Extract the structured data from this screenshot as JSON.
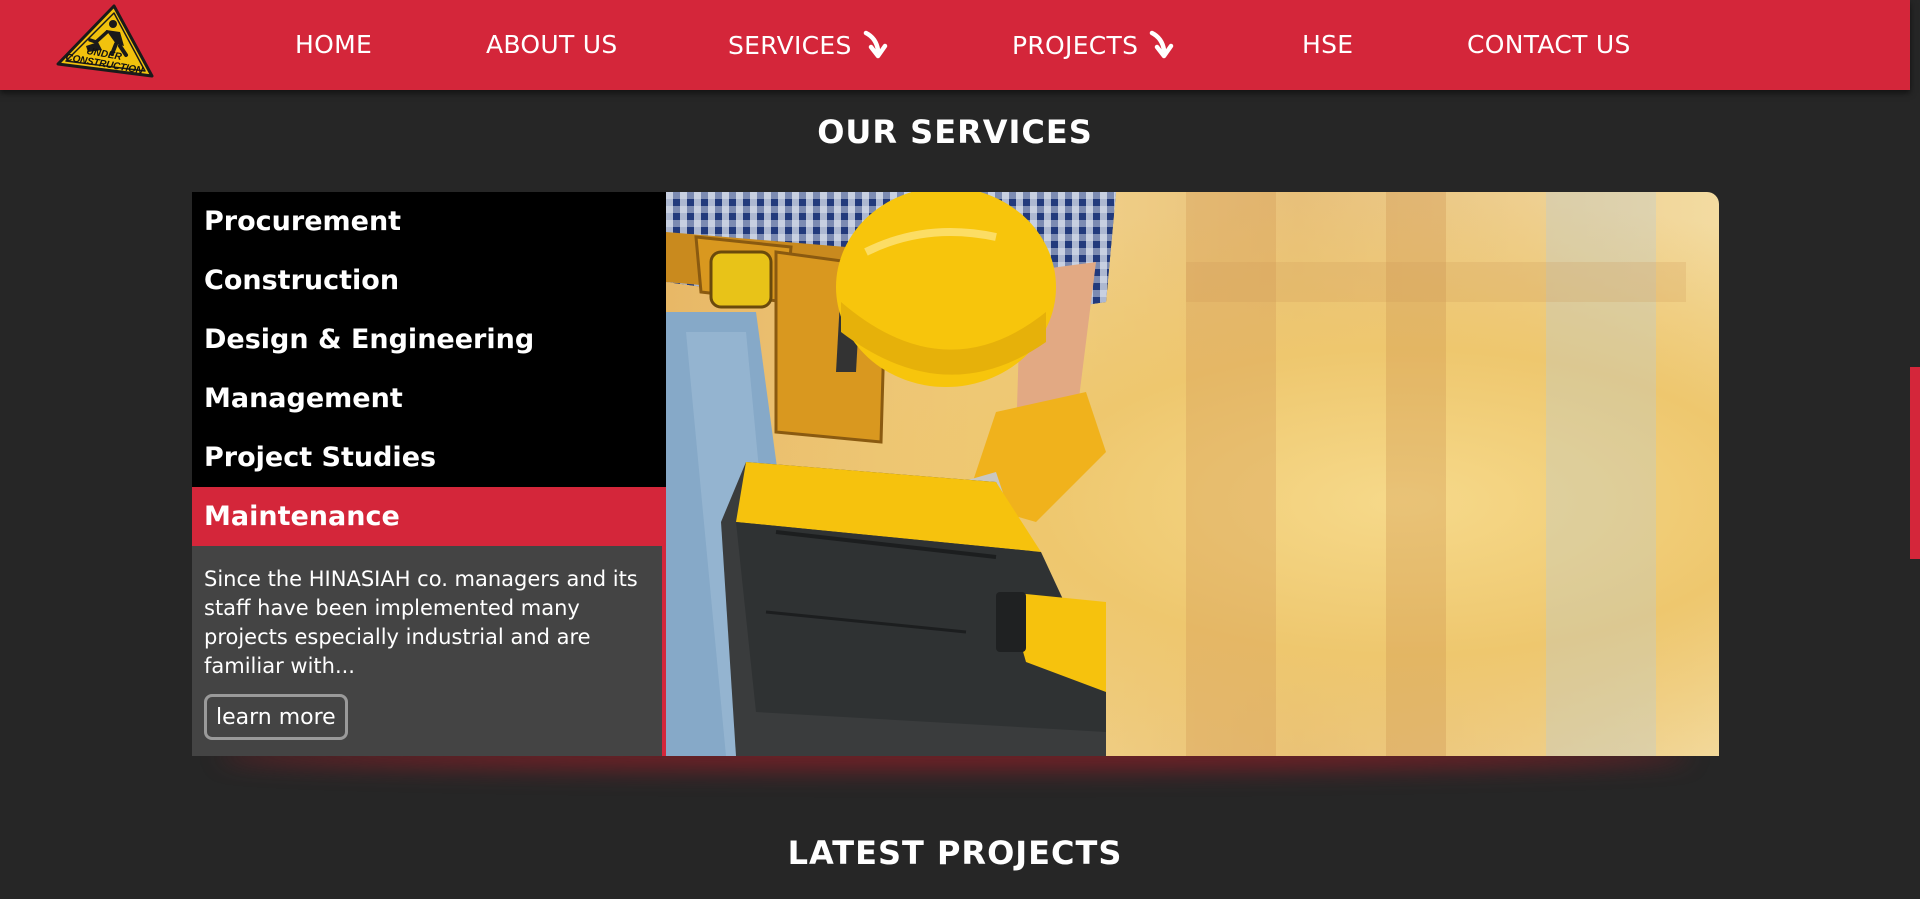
{
  "header": {
    "logo": {
      "line1": "UNDER",
      "line2": "CONSTRUCTION"
    },
    "nav": [
      {
        "label": "HOME"
      },
      {
        "label": "ABOUT US"
      },
      {
        "label": "SERVICES",
        "icon": "arrow-down-right-icon"
      },
      {
        "label": "PROJECTS",
        "icon": "arrow-down-right-icon"
      },
      {
        "label": "HSE"
      },
      {
        "label": "CONTACT US"
      }
    ]
  },
  "services": {
    "title": "OUR SERVICES",
    "items": [
      {
        "label": "Procurement",
        "active": false
      },
      {
        "label": "Construction",
        "active": false
      },
      {
        "label": "Design & Engineering",
        "active": false
      },
      {
        "label": "Management",
        "active": false
      },
      {
        "label": "Project Studies",
        "active": false
      },
      {
        "label": "Maintenance",
        "active": true
      }
    ],
    "description": "Since the HINASIAH co. managers and its staff have been implemented many projects especially industrial and are familiar with...",
    "button_label": "learn more"
  },
  "projects": {
    "title": "LATEST PROJECTS"
  },
  "colors": {
    "brand_red": "#d4263a",
    "page_background": "#262626",
    "menu_background": "#000000",
    "description_background": "#444444"
  }
}
